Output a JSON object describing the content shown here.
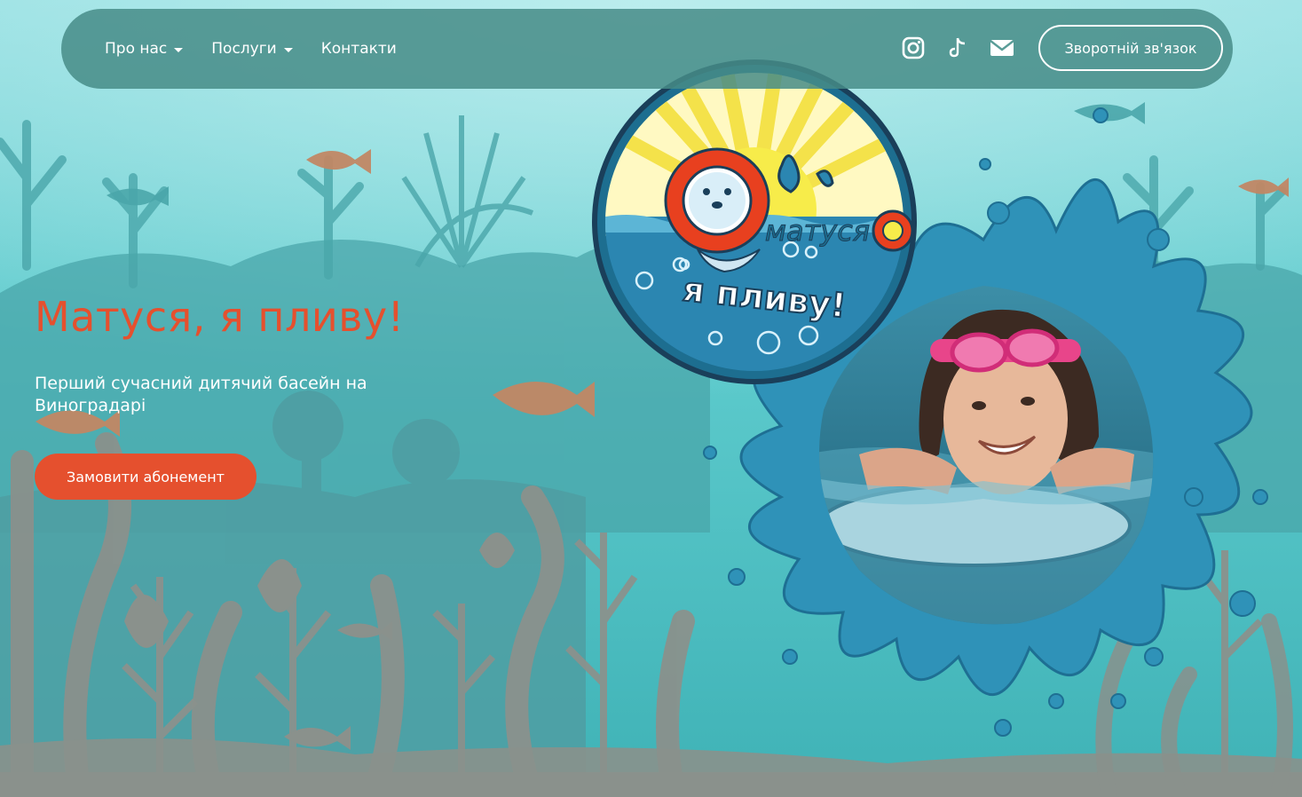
{
  "nav": {
    "items": [
      {
        "label": "Про нас",
        "has_dropdown": true
      },
      {
        "label": "Послуги",
        "has_dropdown": true
      },
      {
        "label": "Контакти",
        "has_dropdown": false
      }
    ],
    "socials": [
      "instagram-icon",
      "tiktok-icon",
      "mail-icon"
    ],
    "feedback_label": "Зворотній зв'язок"
  },
  "hero": {
    "title": "Матуся, я пливу!",
    "subtitle": "Перший сучасний дитячий басейн на Виноградарі",
    "cta_label": "Замовити абонемент"
  },
  "logo": {
    "word_top": "матуся",
    "word_bottom": "я пливу!"
  },
  "colors": {
    "accent": "#e5502e",
    "nav_bg": "#468c87",
    "water": "#57c6c9"
  }
}
